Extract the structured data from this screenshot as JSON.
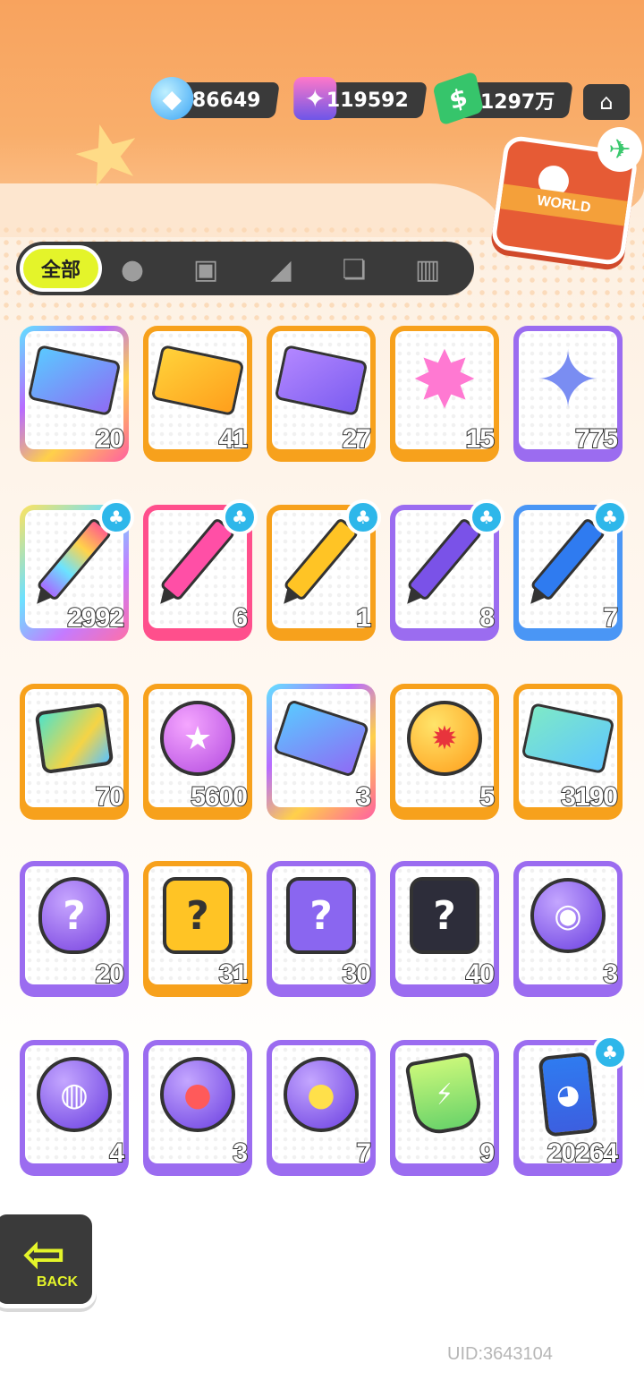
{
  "currencies": {
    "gems": "86649",
    "spray": "119592",
    "cash": "1297万"
  },
  "world_case": {
    "label": "WORLD"
  },
  "tabs": {
    "all_label": "全部",
    "icons": [
      "person-icon",
      "box-icon",
      "spray-icon",
      "cards-icon",
      "book-icon"
    ]
  },
  "items": [
    {
      "name": "ticket-rainbow",
      "count": "20"
    },
    {
      "name": "ticket-gold",
      "count": "41"
    },
    {
      "name": "ticket-purple",
      "count": "27"
    },
    {
      "name": "rainbow-star",
      "count": "15"
    },
    {
      "name": "crystal-star",
      "count": "775"
    },
    {
      "name": "crayon-rainbow",
      "count": "2992"
    },
    {
      "name": "crayon-pink",
      "count": "6"
    },
    {
      "name": "crayon-yellow",
      "count": "1"
    },
    {
      "name": "crayon-purple",
      "count": "8"
    },
    {
      "name": "crayon-blue",
      "count": "7"
    },
    {
      "name": "color-cube",
      "count": "70"
    },
    {
      "name": "cool-orb",
      "count": "5600"
    },
    {
      "name": "lottery-ticket",
      "count": "3"
    },
    {
      "name": "burst-orb",
      "count": "5"
    },
    {
      "name": "season-ticket",
      "count": "3190"
    },
    {
      "name": "mystery-egg",
      "count": "20"
    },
    {
      "name": "deity-card-yellow",
      "count": "31"
    },
    {
      "name": "deity-card-purple",
      "count": "30"
    },
    {
      "name": "travel-card",
      "count": "40"
    },
    {
      "name": "pet-orb-bat",
      "count": "3"
    },
    {
      "name": "pet-orb-fish",
      "count": "4"
    },
    {
      "name": "pet-orb-shark",
      "count": "3"
    },
    {
      "name": "pet-orb-jelly",
      "count": "7"
    },
    {
      "name": "open-cup",
      "count": "9"
    },
    {
      "name": "spray-can",
      "count": "20264"
    }
  ],
  "back_button": {
    "label": "BACK"
  },
  "uid": "UID:3643104"
}
